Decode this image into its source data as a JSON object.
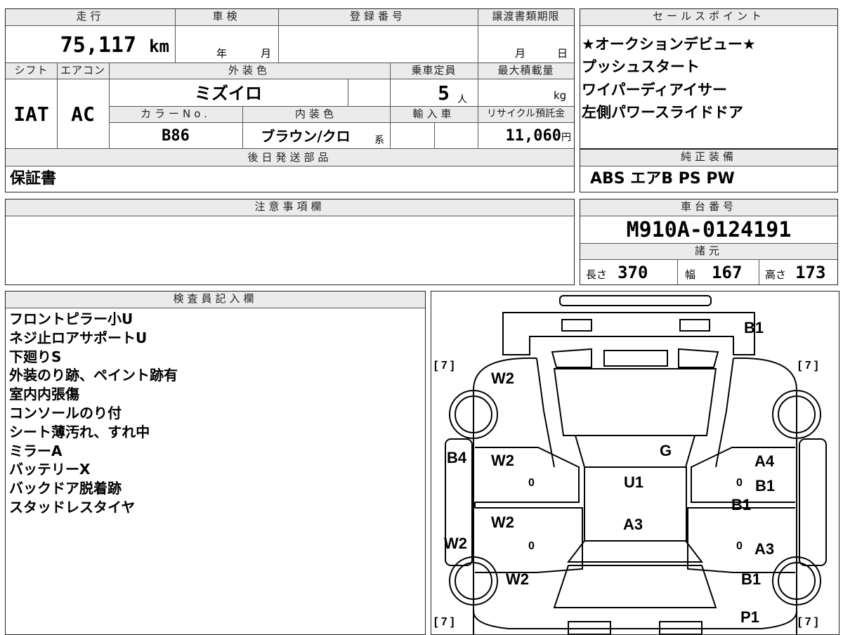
{
  "top": {
    "mileage_label": "走行",
    "mileage_value": "75,117",
    "mileage_unit": "km",
    "inspection_label": "車検",
    "inspection_year": "年",
    "inspection_month": "月",
    "registration_label": "登録番号",
    "transfer_label": "譲渡書類期限",
    "transfer_month": "月",
    "transfer_day": "日",
    "shift_label": "シフト",
    "shift_value": "IAT",
    "ac_label": "エアコン",
    "ac_value": "AC",
    "exterior_label": "外装色",
    "exterior_value": "ミズイロ",
    "capacity_label": "乗車定員",
    "capacity_value": "5",
    "capacity_unit": "人",
    "maxload_label": "最大積載量",
    "maxload_unit": "kg",
    "color_no_label": "カラーNo.",
    "color_no_value": "B86",
    "interior_label": "内装色",
    "interior_value": "ブラウン/クロ",
    "interior_suffix": "系",
    "import_label": "輸入車",
    "recycle_label": "リサイクル預託金",
    "recycle_value": "11,060",
    "recycle_unit": "円",
    "later_parts_label": "後日発送部品",
    "later_parts_value": "保証書"
  },
  "sales": {
    "label": "セールスポイント",
    "items": [
      "★オークションデビュー★",
      "プッシュスタート",
      "ワイパーディアイサー",
      "左側パワースライドドア"
    ]
  },
  "equipment": {
    "label": "純正装備",
    "value": "ABS エアB PS PW"
  },
  "caution": {
    "label": "注意事項欄"
  },
  "chassis": {
    "label": "車台番号",
    "value": "M910A-0124191",
    "spec_label": "諸元",
    "length_label": "長さ",
    "length_value": "370",
    "width_label": "幅",
    "width_value": "167",
    "height_label": "高さ",
    "height_value": "173"
  },
  "inspector": {
    "label": "検査員記入欄",
    "notes": [
      "フロントピラー小U",
      "ネジ止ロアサポートU",
      "下廻りS",
      "外装のり跡、ペイント跡有",
      "室内内張傷",
      "コンソールのり付",
      "シート薄汚れ、すれ中",
      "ミラーA",
      "バッテリーX",
      "バックドア脱着跡",
      "スタッドレスタイヤ"
    ]
  },
  "diagram": {
    "bracket_tl": "[ 7 ]",
    "bracket_tr": "[ 7 ]",
    "bracket_bl": "[ 7 ]",
    "bracket_br": "[ 7 ]",
    "marks": {
      "b1_top": "B1",
      "w2_front_left": "W2",
      "b4": "B4",
      "w2_door_front": "W2",
      "g": "G",
      "a4": "A4",
      "u1": "U1",
      "b1_right": "B1",
      "b1_sill": "B1",
      "w2_door_rear": "W2",
      "a3_center": "A3",
      "w2_left_edge": "W2",
      "a3_right": "A3",
      "w2_rear": "W2",
      "b1_rear": "B1",
      "p1": "P1",
      "zero_1": "0",
      "zero_2": "0",
      "zero_3": "0",
      "zero_4": "0"
    }
  }
}
